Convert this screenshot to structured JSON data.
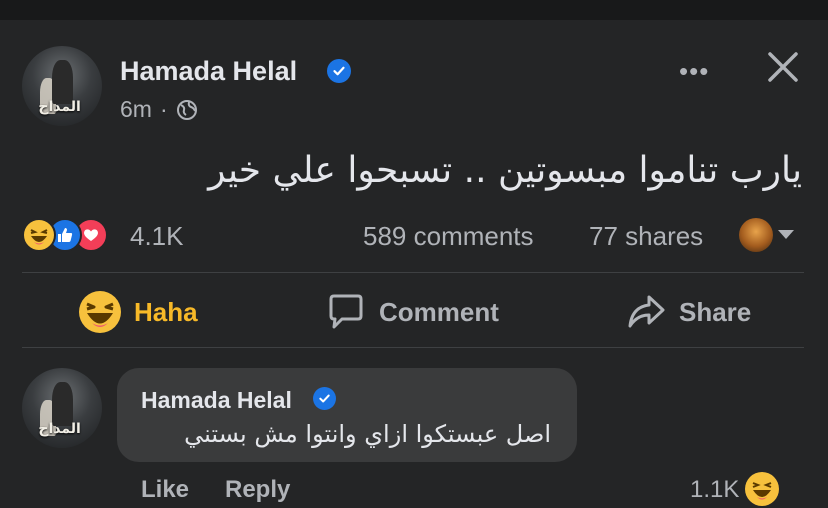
{
  "post": {
    "author": "Hamada Helal",
    "avatar_logo_text": "المداح",
    "time": "6m",
    "separator": "·",
    "text": "يارب تناموا مبسوتين .. تسبحوا علي خير",
    "reaction_count": "4.1K",
    "comments": "589 comments",
    "shares": "77 shares",
    "reaction_icons": [
      "haha-icon",
      "like-icon",
      "love-icon"
    ]
  },
  "actions": {
    "haha": "Haha",
    "comment": "Comment",
    "share": "Share"
  },
  "comment": {
    "author": "Hamada Helal",
    "avatar_logo_text": "المداح",
    "text": "اصل عبستكوا ازاي وانتوا مش بستني",
    "like": "Like",
    "reply": "Reply",
    "reaction_count": "1.1K"
  },
  "colors": {
    "background": "#242526",
    "bubble": "#3a3b3c",
    "verified": "#1b74e4",
    "haha": "#f7b928"
  }
}
